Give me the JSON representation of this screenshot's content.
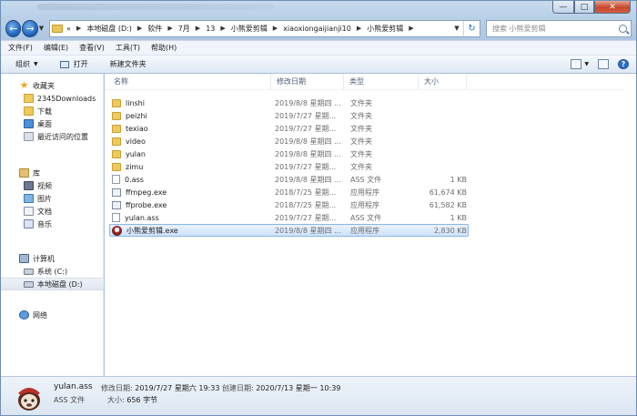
{
  "window": {
    "minimize_glyph": "—",
    "maximize_glyph": "□",
    "close_glyph": "✕"
  },
  "address": {
    "overflow": "«",
    "crumbs": [
      "本地磁盘 (D:)",
      "软件",
      "7月",
      "13",
      "小熊爱剪辑",
      "xiaoxiongaijianji10",
      "小熊爱剪辑"
    ],
    "search_placeholder": "搜索 小熊爱剪辑"
  },
  "menu": [
    "文件(F)",
    "编辑(E)",
    "查看(V)",
    "工具(T)",
    "帮助(H)"
  ],
  "toolbar": {
    "organize": "组织",
    "open": "打开",
    "new_folder": "新建文件夹"
  },
  "nav": {
    "favorites": {
      "label": "收藏夹",
      "items": [
        "2345Downloads",
        "下载",
        "桌面",
        "最近访问的位置"
      ]
    },
    "libraries": {
      "label": "库",
      "items": [
        "视频",
        "图片",
        "文档",
        "音乐"
      ]
    },
    "computer": {
      "label": "计算机",
      "items": [
        "系统 (C:)",
        "本地磁盘 (D:)"
      ]
    },
    "network": {
      "label": "网络"
    }
  },
  "columns": {
    "name": "名称",
    "date": "修改日期",
    "type": "类型",
    "size": "大小"
  },
  "files": [
    {
      "name": "linshi",
      "date": "2019/8/8 星期四 ...",
      "type": "文件夹",
      "size": "",
      "icon": "folder"
    },
    {
      "name": "peizhi",
      "date": "2019/7/27 星期...",
      "type": "文件夹",
      "size": "",
      "icon": "folder"
    },
    {
      "name": "texiao",
      "date": "2019/7/27 星期...",
      "type": "文件夹",
      "size": "",
      "icon": "folder"
    },
    {
      "name": "video",
      "date": "2019/8/8 星期四 ...",
      "type": "文件夹",
      "size": "",
      "icon": "folder"
    },
    {
      "name": "yulan",
      "date": "2019/8/8 星期四 ...",
      "type": "文件夹",
      "size": "",
      "icon": "folder"
    },
    {
      "name": "zimu",
      "date": "2019/7/27 星期...",
      "type": "文件夹",
      "size": "",
      "icon": "folder"
    },
    {
      "name": "0.ass",
      "date": "2019/8/8 星期四 ...",
      "type": "ASS 文件",
      "size": "1 KB",
      "icon": "ass"
    },
    {
      "name": "ffmpeg.exe",
      "date": "2018/7/25 星期...",
      "type": "应用程序",
      "size": "61,674 KB",
      "icon": "exe"
    },
    {
      "name": "ffprobe.exe",
      "date": "2018/7/25 星期...",
      "type": "应用程序",
      "size": "61,582 KB",
      "icon": "exe"
    },
    {
      "name": "yulan.ass",
      "date": "2019/7/27 星期...",
      "type": "ASS 文件",
      "size": "1 KB",
      "icon": "ass"
    },
    {
      "name": "小熊爱剪辑.exe",
      "date": "2019/8/8 星期四 ...",
      "type": "应用程序",
      "size": "2,830 KB",
      "icon": "app"
    }
  ],
  "details": {
    "name": "yulan.ass",
    "modified_label": "修改日期:",
    "modified_value": "2019/7/27 星期六 19:33",
    "created_label": "创建日期:",
    "created_value": "2020/7/13 星期一 10:39",
    "type": "ASS 文件",
    "size_label": "大小:",
    "size_value": "656 字节"
  }
}
